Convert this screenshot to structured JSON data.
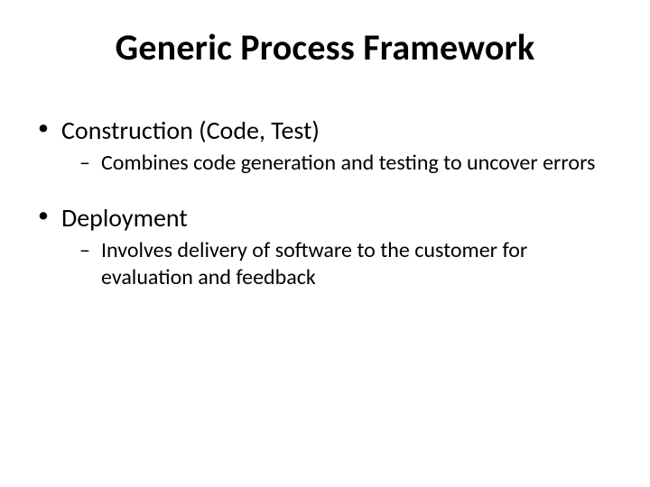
{
  "title": "Generic Process Framework",
  "items": [
    {
      "label": "Construction (Code, Test)",
      "sub": "Combines code generation and testing to uncover errors"
    },
    {
      "label": "Deployment",
      "sub": "Involves delivery of software to the customer for evaluation and feedback"
    }
  ]
}
